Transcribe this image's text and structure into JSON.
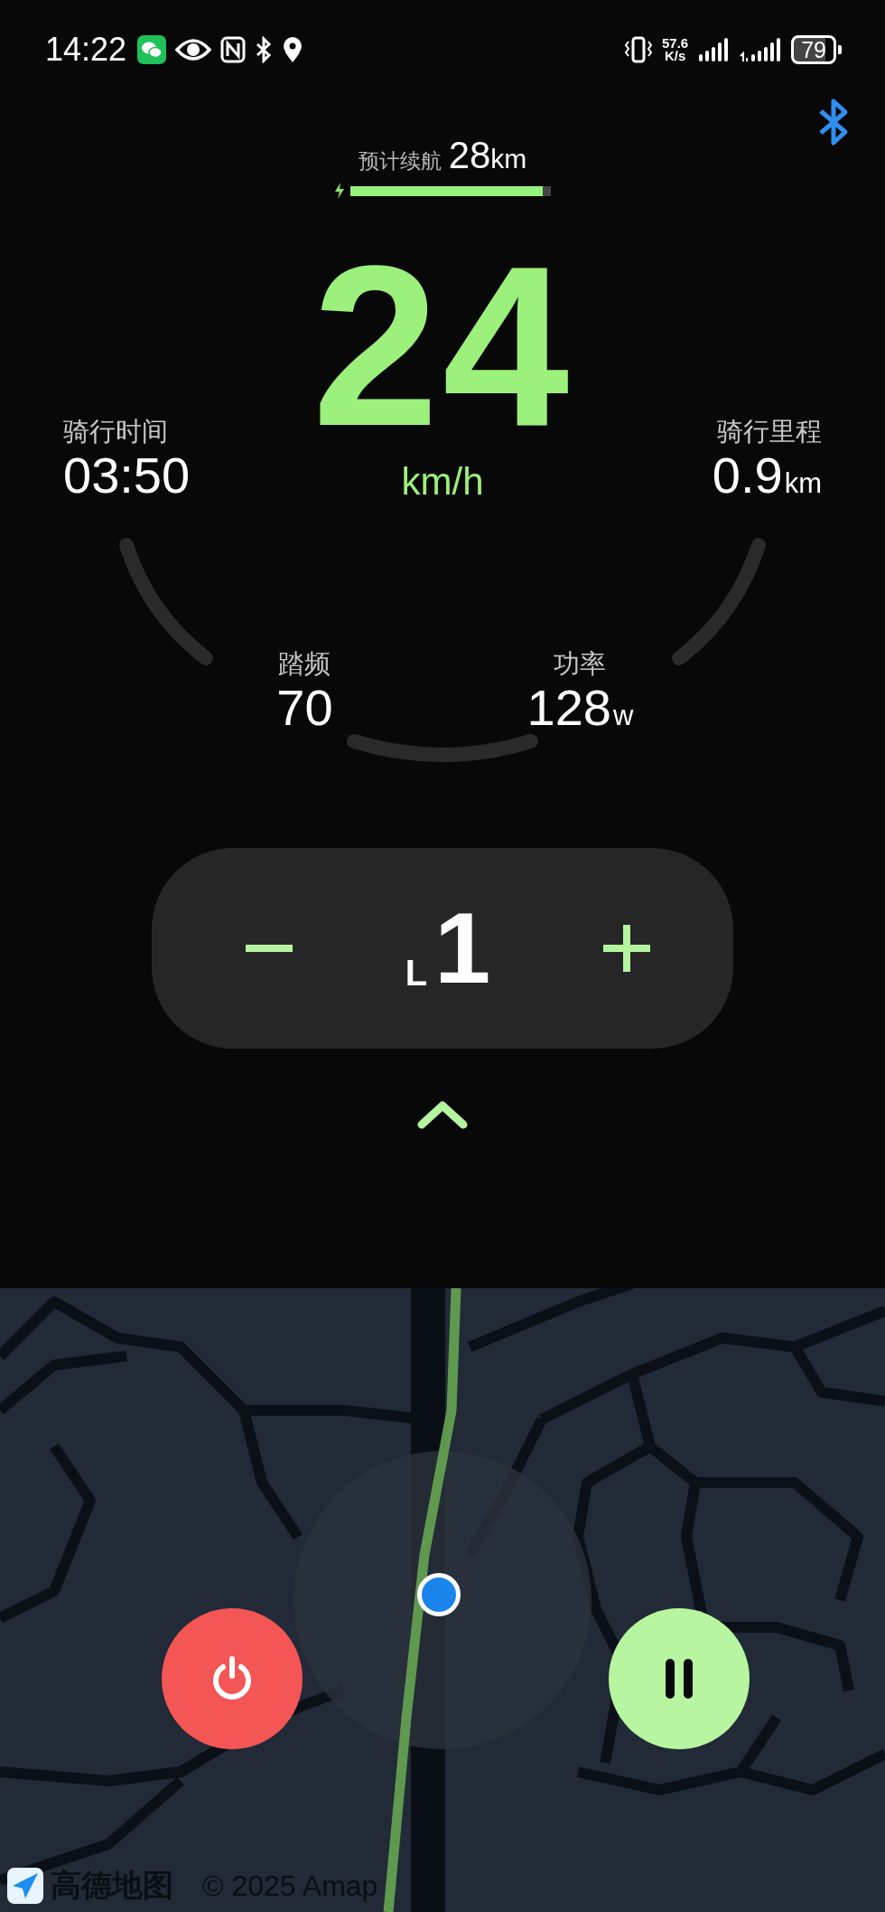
{
  "status_bar": {
    "time": "14:22",
    "speed_value": "57.6",
    "speed_unit": "K/s",
    "battery": "79"
  },
  "range": {
    "label": "预计续航",
    "value": "28",
    "unit": "km",
    "level": 0.96
  },
  "speed": {
    "value": "24",
    "unit": "km/h"
  },
  "stats": [
    {
      "label": "骑行时间",
      "value": "03:50"
    },
    {
      "label": "骑行里程",
      "value": "0.9",
      "unit": "km"
    },
    {
      "label": "踏频",
      "value": "70"
    },
    {
      "label": "功率",
      "value": "128",
      "unit": "w"
    }
  ],
  "gear": {
    "prefix": "L",
    "value": "1"
  },
  "map": {
    "logo_text": "高德地图",
    "copyright": "© 2025 Amap"
  }
}
